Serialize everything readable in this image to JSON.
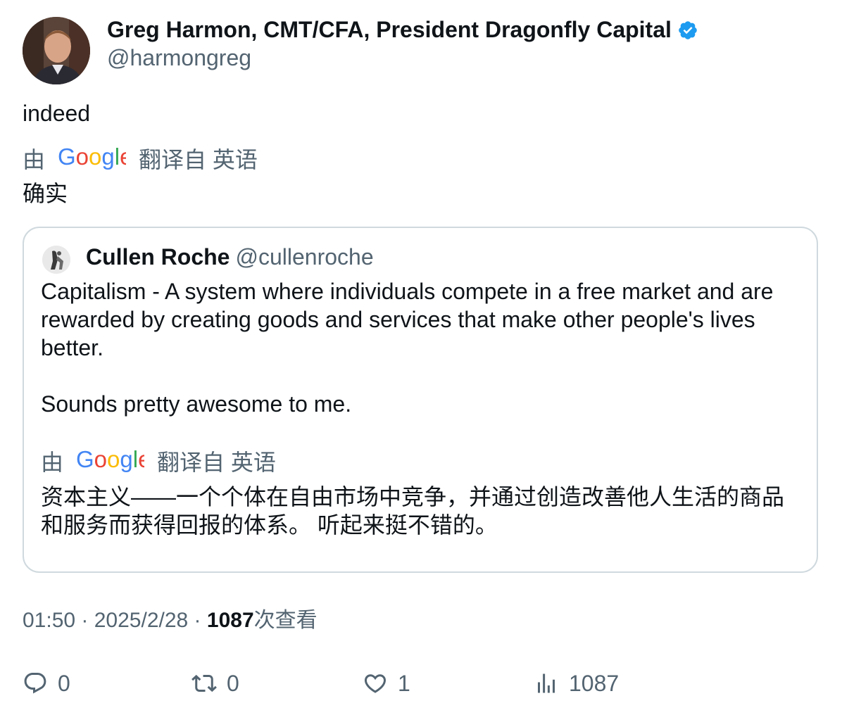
{
  "author": {
    "name": "Greg Harmon, CMT/CFA, President Dragonfly Capital",
    "handle": "@harmongreg",
    "verified_icon": "verified-badge-icon",
    "avatar": "avatar-photo"
  },
  "tweet": {
    "text": "indeed",
    "translation": {
      "prefix": "由",
      "logo": "Google",
      "suffix": "翻译自 英语",
      "text": "确实"
    }
  },
  "quoted": {
    "name": "Cullen Roche",
    "handle": "@cullenroche",
    "text": "Capitalism - A system where individuals compete in a free market and are rewarded by creating goods and services that make other people's lives better.\n\nSounds pretty awesome to me.",
    "translation": {
      "prefix": "由",
      "logo": "Google",
      "suffix": "翻译自 英语",
      "text": "资本主义——一个个体在自由市场中竞争，并通过创造改善他人生活的商品和服务而获得回报的体系。 听起来挺不错的。"
    }
  },
  "meta": {
    "time": "01:50",
    "sep1": " · ",
    "date": "2025/2/28",
    "sep2": " · ",
    "views": "1087",
    "views_label": "次查看"
  },
  "actions": {
    "reply_count": "0",
    "retweet_count": "0",
    "like_count": "1",
    "view_count": "1087"
  },
  "colors": {
    "text": "#0f1419",
    "secondary": "#536471",
    "border": "#cfd9de",
    "verified": "#1d9bf0"
  }
}
